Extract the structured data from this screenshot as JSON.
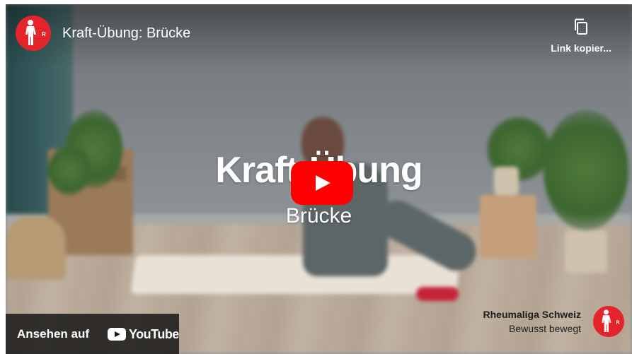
{
  "header": {
    "channel_avatar_icon": "rheumaliga-figure-logo",
    "video_title": "Kraft-Übung: Brücke",
    "copy_link": {
      "icon": "copy-icon",
      "label": "Link kopier..."
    }
  },
  "video": {
    "overlay_title": "Kraft-Übung",
    "overlay_subtitle": "Brücke",
    "play_icon": "play-icon",
    "play_color": "#ff0000"
  },
  "watch_on": {
    "label": "Ansehen auf",
    "logo_text": "YouTube"
  },
  "branding": {
    "name": "Rheumaliga Schweiz",
    "tagline": "Bewusst bewegt",
    "logo_icon": "rheumaliga-figure-logo",
    "brand_color": "#e3242b"
  }
}
